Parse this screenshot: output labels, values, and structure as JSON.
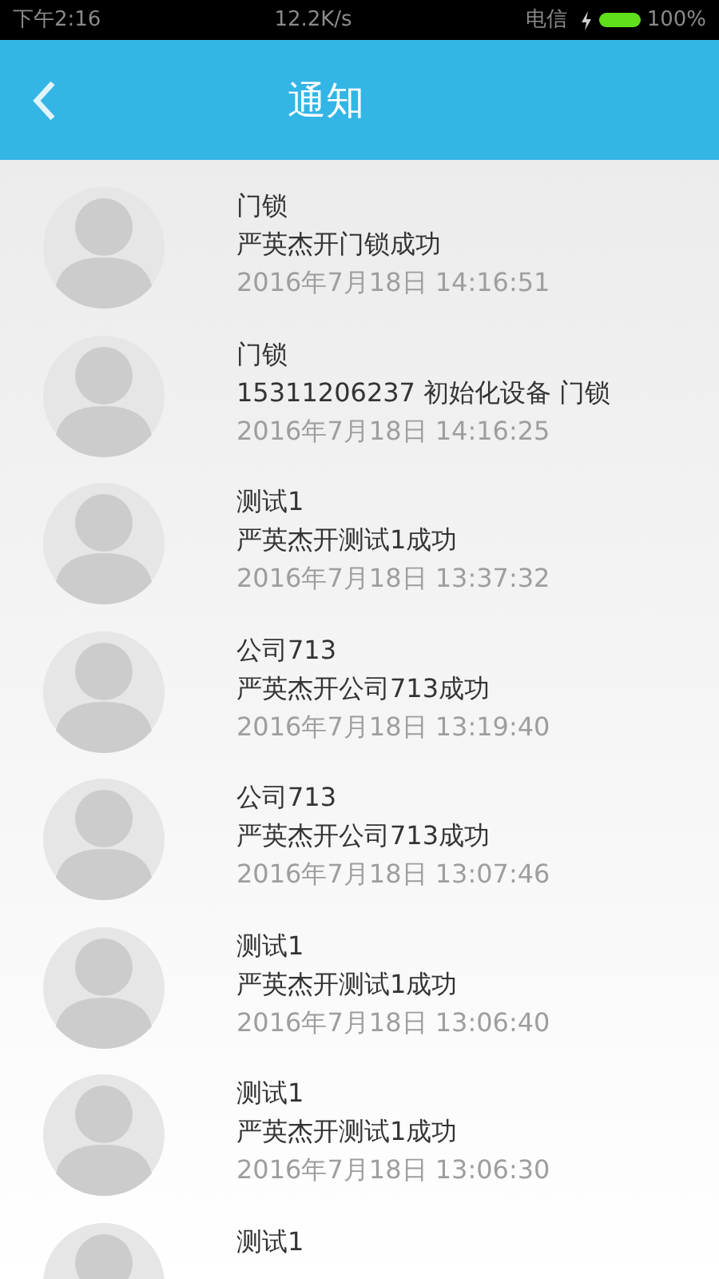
{
  "status_bar": {
    "time": "下午2:16",
    "speed": "12.2K/s",
    "carrier": "电信",
    "battery": "100%"
  },
  "header": {
    "title": "通知"
  },
  "notifications": [
    {
      "title": "门锁",
      "message": "严英杰开门锁成功",
      "time": "2016年7月18日 14:16:51"
    },
    {
      "title": "门锁",
      "message": "15311206237 初始化设备 门锁",
      "time": "2016年7月18日 14:16:25"
    },
    {
      "title": "测试1",
      "message": "严英杰开测试1成功",
      "time": "2016年7月18日 13:37:32"
    },
    {
      "title": "公司713",
      "message": "严英杰开公司713成功",
      "time": "2016年7月18日 13:19:40"
    },
    {
      "title": "公司713",
      "message": "严英杰开公司713成功",
      "time": "2016年7月18日 13:07:46"
    },
    {
      "title": "测试1",
      "message": "严英杰开测试1成功",
      "time": "2016年7月18日 13:06:40"
    },
    {
      "title": "测试1",
      "message": "严英杰开测试1成功",
      "time": "2016年7月18日 13:06:30"
    },
    {
      "title": "测试1"
    }
  ]
}
